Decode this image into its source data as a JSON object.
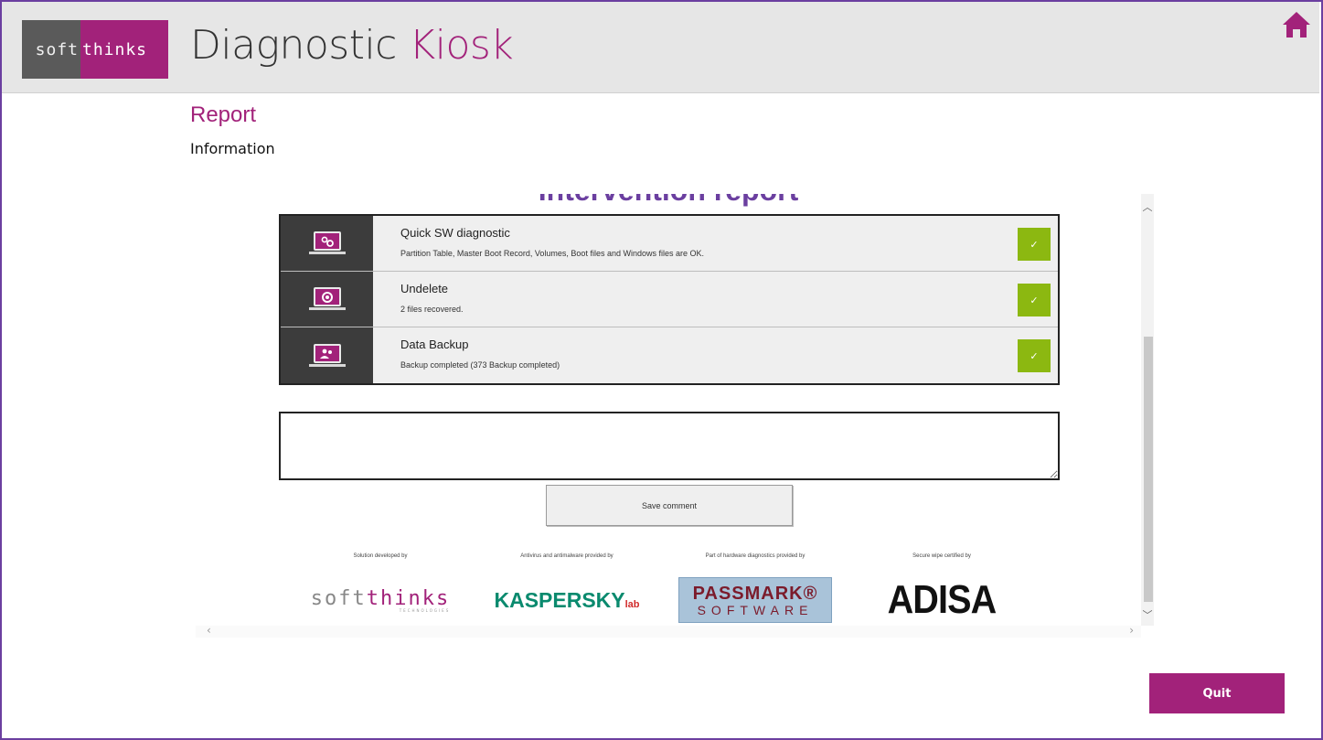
{
  "brand": {
    "logo_left": "soft",
    "logo_right": "thinks",
    "title_main": "Diagnostic",
    "title_accent": "Kiosk",
    "accent_color": "#a2227a",
    "frame_color": "#6b3fa0"
  },
  "header": {
    "home_icon": "home-icon"
  },
  "page": {
    "title": "Report",
    "subtitle": "Information"
  },
  "report": {
    "heading": "Intervention report",
    "rows": [
      {
        "icon": "gears-icon",
        "title": "Quick SW diagnostic",
        "description": "Partition Table, Master Boot Record, Volumes, Boot files and Windows files are OK.",
        "status": "✓"
      },
      {
        "icon": "undelete-icon",
        "title": "Undelete",
        "description": "2 files recovered.",
        "status": "✓"
      },
      {
        "icon": "backup-icon",
        "title": "Data Backup",
        "description": "Backup completed (373 Backup completed)",
        "status": "✓"
      }
    ],
    "comment_placeholder": "",
    "save_comment_label": "Save comment",
    "status_color": "#8cb811"
  },
  "credits": [
    {
      "caption": "Solution developed by",
      "brand": "softthinks"
    },
    {
      "caption": "Antivirus and antimalware provided by",
      "brand": "KASPERSKY"
    },
    {
      "caption": "Part of hardware diagnostics provided by",
      "brand": "PASSMARK SOFTWARE"
    },
    {
      "caption": "Secure wipe certified by",
      "brand": "ADISA"
    }
  ],
  "credit_brands": {
    "soft_a": "soft",
    "soft_b": "thinks",
    "soft_sub": "TECHNOLOGIES",
    "kasp": "KASPERSKY",
    "kasp_small": "lab",
    "pass_1": "PASSMARK®",
    "pass_2": "SOFTWARE",
    "adisa": "ADISA"
  },
  "footer": {
    "quit_label": "Quit"
  }
}
